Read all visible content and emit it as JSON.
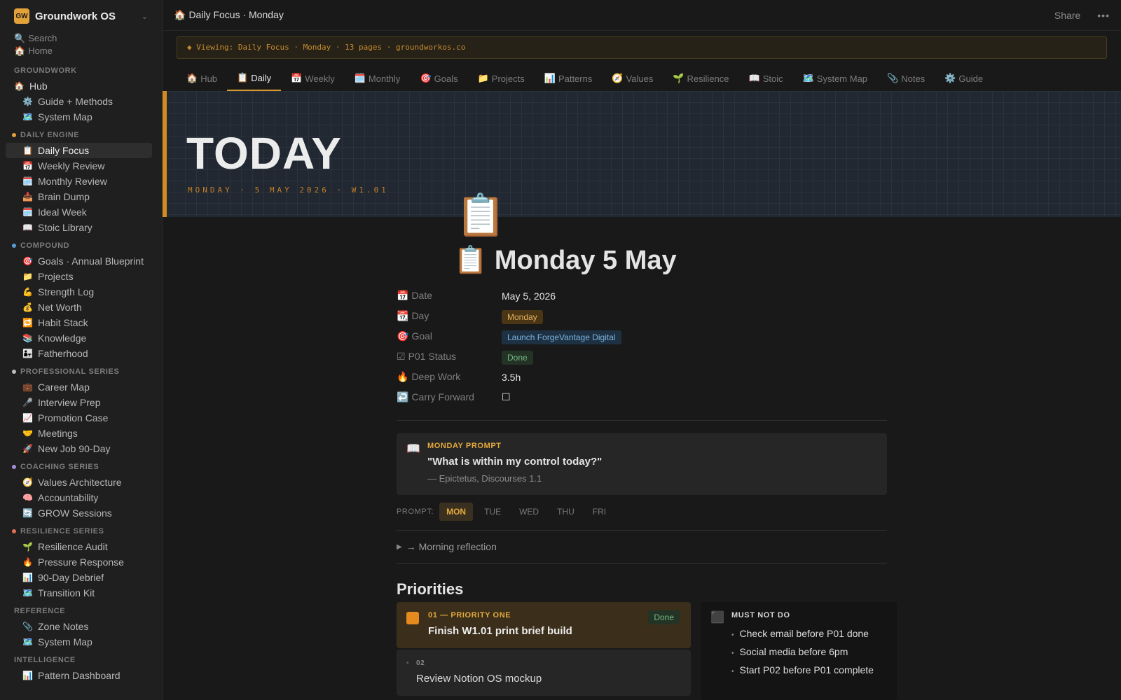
{
  "workspace": {
    "logo": "GW",
    "name": "Groundwork OS",
    "chevron": "⌄"
  },
  "sidebar": {
    "search": "Search",
    "home": "Home",
    "sections": [
      {
        "title": "GROUNDWORK",
        "dot": "",
        "items": [
          {
            "icon": "🏠",
            "label": "Hub",
            "root": true
          },
          {
            "icon": "⚙️",
            "label": "Guide + Methods"
          },
          {
            "icon": "🗺️",
            "label": "System Map"
          }
        ]
      },
      {
        "title": "DAILY ENGINE",
        "dot": "#e2a23a",
        "items": [
          {
            "icon": "📋",
            "label": "Daily Focus",
            "active": true
          },
          {
            "icon": "📅",
            "label": "Weekly Review"
          },
          {
            "icon": "🗓️",
            "label": "Monthly Review"
          },
          {
            "icon": "📥",
            "label": "Brain Dump"
          },
          {
            "icon": "🗓️",
            "label": "Ideal Week"
          },
          {
            "icon": "📖",
            "label": "Stoic Library"
          }
        ]
      },
      {
        "title": "COMPOUND",
        "dot": "#5b9bd5",
        "items": [
          {
            "icon": "🎯",
            "label": "Goals · Annual Blueprint"
          },
          {
            "icon": "📁",
            "label": "Projects"
          },
          {
            "icon": "💪",
            "label": "Strength Log"
          },
          {
            "icon": "💰",
            "label": "Net Worth"
          },
          {
            "icon": "🔁",
            "label": "Habit Stack"
          },
          {
            "icon": "📚",
            "label": "Knowledge"
          },
          {
            "icon": "👨‍👧",
            "label": "Fatherhood"
          }
        ]
      },
      {
        "title": "PROFESSIONAL SERIES",
        "dot": "#bdbdbd",
        "items": [
          {
            "icon": "💼",
            "label": "Career Map"
          },
          {
            "icon": "🎤",
            "label": "Interview Prep"
          },
          {
            "icon": "📈",
            "label": "Promotion Case"
          },
          {
            "icon": "🤝",
            "label": "Meetings"
          },
          {
            "icon": "🚀",
            "label": "New Job 90-Day"
          }
        ]
      },
      {
        "title": "COACHING SERIES",
        "dot": "#a48cd6",
        "items": [
          {
            "icon": "🧭",
            "label": "Values Architecture"
          },
          {
            "icon": "🧠",
            "label": "Accountability"
          },
          {
            "icon": "🔄",
            "label": "GROW Sessions"
          }
        ]
      },
      {
        "title": "RESILIENCE SERIES",
        "dot": "#e0705a",
        "items": [
          {
            "icon": "🌱",
            "label": "Resilience Audit"
          },
          {
            "icon": "🔥",
            "label": "Pressure Response"
          },
          {
            "icon": "📊",
            "label": "90-Day Debrief"
          },
          {
            "icon": "🗺️",
            "label": "Transition Kit"
          }
        ]
      },
      {
        "title": "REFERENCE",
        "dot": "",
        "items": [
          {
            "icon": "📎",
            "label": "Zone Notes"
          },
          {
            "icon": "🗺️",
            "label": "System Map"
          }
        ]
      },
      {
        "title": "INTELLIGENCE",
        "dot": "",
        "items": [
          {
            "icon": "📊",
            "label": "Pattern Dashboard"
          }
        ]
      }
    ]
  },
  "topbar": {
    "icon": "🏠",
    "breadcrumb": "Daily Focus · Monday",
    "share": "Share",
    "more": "•••"
  },
  "banner": "◆ Viewing: Daily Focus · Monday · 13 pages · groundworkos.co",
  "tabs": [
    {
      "icon": "🏠",
      "label": "Hub"
    },
    {
      "icon": "📋",
      "label": "Daily",
      "active": true
    },
    {
      "icon": "📅",
      "label": "Weekly"
    },
    {
      "icon": "🗓️",
      "label": "Monthly"
    },
    {
      "icon": "🎯",
      "label": "Goals"
    },
    {
      "icon": "📁",
      "label": "Projects"
    },
    {
      "icon": "📊",
      "label": "Patterns"
    },
    {
      "icon": "🧭",
      "label": "Values"
    },
    {
      "icon": "🌱",
      "label": "Resilience"
    },
    {
      "icon": "📖",
      "label": "Stoic"
    },
    {
      "icon": "🗺️",
      "label": "System Map"
    },
    {
      "icon": "📎",
      "label": "Notes"
    },
    {
      "icon": "⚙️",
      "label": "Guide"
    }
  ],
  "hero": {
    "title": "TODAY",
    "subtitle": "MONDAY · 5 MAY 2026 · W1.01"
  },
  "page": {
    "icon": "📋",
    "title_icon": "📋",
    "title": "Monday 5 May",
    "properties": [
      {
        "icon": "📅",
        "key": "Date",
        "value": "May 5, 2026",
        "type": "text"
      },
      {
        "icon": "📆",
        "key": "Day",
        "value": "Monday",
        "type": "tag",
        "color": "orange"
      },
      {
        "icon": "🎯",
        "key": "Goal",
        "value": "Launch ForgeVantage Digital",
        "type": "tag",
        "color": "blue"
      },
      {
        "icon": "☑",
        "key": "P01 Status",
        "value": "Done",
        "type": "tag",
        "color": "green"
      },
      {
        "icon": "🔥",
        "key": "Deep Work",
        "value": "3.5h",
        "type": "text"
      },
      {
        "icon": "↩️",
        "key": "Carry Forward",
        "value": "☐",
        "type": "text"
      }
    ],
    "callout": {
      "icon": "📖",
      "label": "MONDAY PROMPT",
      "quote": "\"What is within my control today?\"",
      "source": "— Epictetus, Discourses 1.1"
    },
    "prompt_row": {
      "label": "PROMPT:",
      "days": [
        "MON",
        "TUE",
        "WED",
        "THU",
        "FRI"
      ],
      "active": "MON"
    },
    "toggle": {
      "arrow": "▶",
      "label": "→ Morning reflection"
    },
    "priorities_heading": "Priorities",
    "priority_one": {
      "label": "01 — PRIORITY ONE",
      "text": "Finish W1.01 print brief build",
      "status": "Done"
    },
    "priority_two": {
      "label": "02",
      "text": "Review Notion OS mockup"
    },
    "must_not_do": {
      "icon": "⬛",
      "label": "MUST NOT DO",
      "items": [
        "Check email before P01 done",
        "Social media before 6pm",
        "Start P02 before P01 complete"
      ]
    }
  }
}
